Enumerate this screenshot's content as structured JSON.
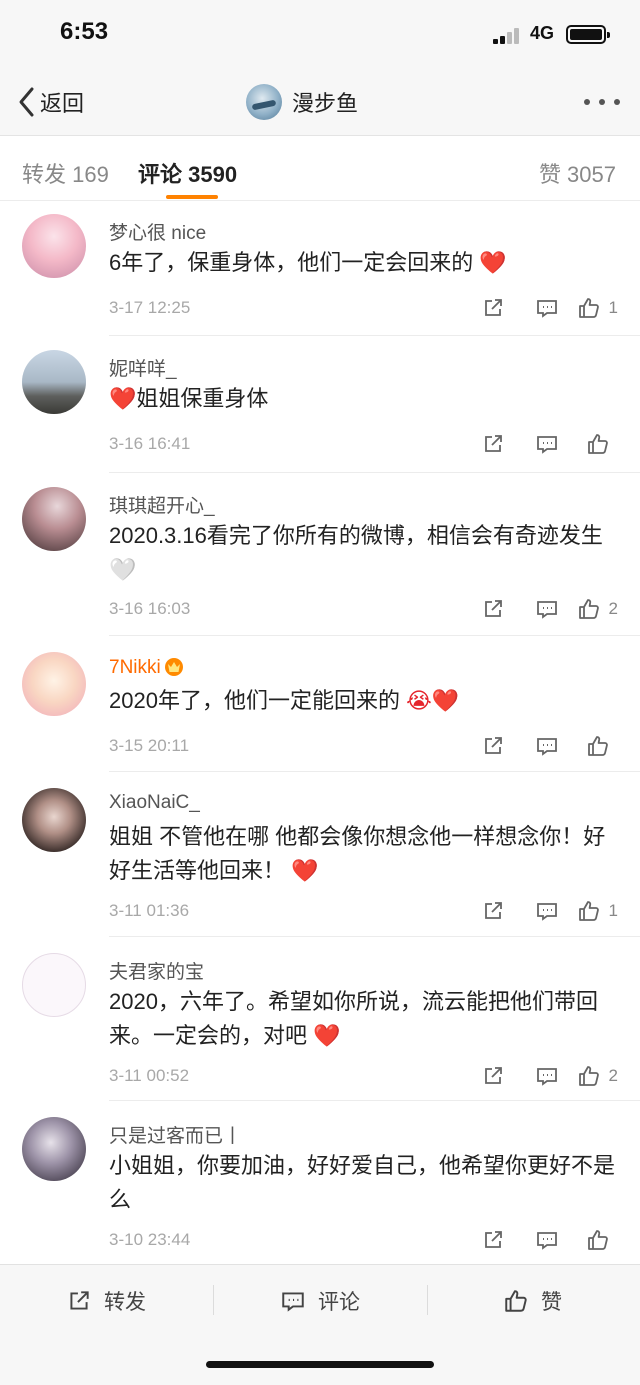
{
  "status_bar": {
    "time": "6:53",
    "network": "4G"
  },
  "nav": {
    "back_label": "返回",
    "title": "漫步鱼"
  },
  "tabs": {
    "repost": "转发 169",
    "comment": "评论 3590",
    "like": "赞 3057"
  },
  "comments": [
    {
      "name": "梦心很 nice",
      "text": "6年了，保重身体，他们一定会回来的",
      "emoji": "❤️",
      "time": "3-17 12:25",
      "likes": "1"
    },
    {
      "name": "妮咩咩_",
      "emoji_lead": "❤️",
      "text": "姐姐保重身体",
      "time": "3-16 16:41",
      "likes": ""
    },
    {
      "name": "琪琪超开心_",
      "text": "2020.3.16看完了你所有的微博，相信会有奇迹发生",
      "emoji": "🤍",
      "time": "3-16 16:03",
      "likes": "2"
    },
    {
      "name": "7Nikki",
      "text": "2020年了，他们一定能回来的",
      "emoji": "😭❤️",
      "time": "3-15 20:11",
      "likes": ""
    },
    {
      "name": "XiaoNaiC_",
      "text": "姐姐 不管他在哪 他都会像你想念他一样想念你！好好生活等他回来！",
      "emoji": "❤️",
      "time": "3-11 01:36",
      "likes": "1"
    },
    {
      "name": "夫君家的宝",
      "text": "2020，六年了。希望如你所说，流云能把他们带回来。一定会的，对吧",
      "emoji": "❤️",
      "time": "3-11 00:52",
      "likes": "2"
    },
    {
      "name": "只是过客而已丨",
      "text": "小姐姐，你要加油，好好爱自己，他希望你更好不是么",
      "emoji": "",
      "time": "3-10 23:44",
      "likes": ""
    }
  ],
  "bottom_bar": {
    "repost": "转发",
    "comment": "评论",
    "like": "赞"
  },
  "colors": {
    "accent": "#ff8200",
    "vip_name": "#ff6a00",
    "heart": "#e5262d"
  }
}
